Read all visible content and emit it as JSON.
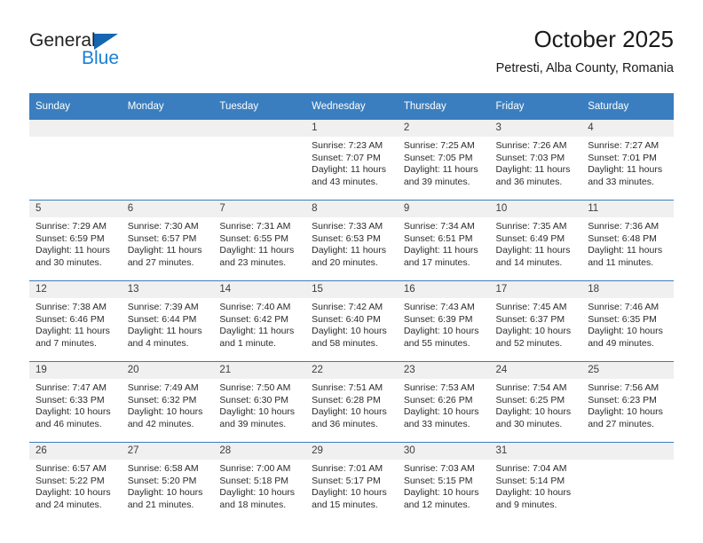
{
  "logo": {
    "word_one": "General",
    "word_two": "Blue",
    "triangle_color": "#1565b0",
    "blue_color": "#1a7fd4"
  },
  "header": {
    "title": "October 2025",
    "subtitle": "Petresti, Alba County, Romania"
  },
  "theme": {
    "header_bg": "#3a7ebf",
    "header_text": "#ffffff",
    "daynum_bg": "#f0f0f0",
    "row_divider": "#3a7ebf",
    "body_text": "#2b2b2b"
  },
  "weekdays": [
    "Sunday",
    "Monday",
    "Tuesday",
    "Wednesday",
    "Thursday",
    "Friday",
    "Saturday"
  ],
  "weeks": [
    [
      {
        "day": "",
        "empty": true
      },
      {
        "day": "",
        "empty": true
      },
      {
        "day": "",
        "empty": true
      },
      {
        "day": "1",
        "sunrise": "Sunrise: 7:23 AM",
        "sunset": "Sunset: 7:07 PM",
        "daylight1": "Daylight: 11 hours",
        "daylight2": "and 43 minutes."
      },
      {
        "day": "2",
        "sunrise": "Sunrise: 7:25 AM",
        "sunset": "Sunset: 7:05 PM",
        "daylight1": "Daylight: 11 hours",
        "daylight2": "and 39 minutes."
      },
      {
        "day": "3",
        "sunrise": "Sunrise: 7:26 AM",
        "sunset": "Sunset: 7:03 PM",
        "daylight1": "Daylight: 11 hours",
        "daylight2": "and 36 minutes."
      },
      {
        "day": "4",
        "sunrise": "Sunrise: 7:27 AM",
        "sunset": "Sunset: 7:01 PM",
        "daylight1": "Daylight: 11 hours",
        "daylight2": "and 33 minutes."
      }
    ],
    [
      {
        "day": "5",
        "sunrise": "Sunrise: 7:29 AM",
        "sunset": "Sunset: 6:59 PM",
        "daylight1": "Daylight: 11 hours",
        "daylight2": "and 30 minutes."
      },
      {
        "day": "6",
        "sunrise": "Sunrise: 7:30 AM",
        "sunset": "Sunset: 6:57 PM",
        "daylight1": "Daylight: 11 hours",
        "daylight2": "and 27 minutes."
      },
      {
        "day": "7",
        "sunrise": "Sunrise: 7:31 AM",
        "sunset": "Sunset: 6:55 PM",
        "daylight1": "Daylight: 11 hours",
        "daylight2": "and 23 minutes."
      },
      {
        "day": "8",
        "sunrise": "Sunrise: 7:33 AM",
        "sunset": "Sunset: 6:53 PM",
        "daylight1": "Daylight: 11 hours",
        "daylight2": "and 20 minutes."
      },
      {
        "day": "9",
        "sunrise": "Sunrise: 7:34 AM",
        "sunset": "Sunset: 6:51 PM",
        "daylight1": "Daylight: 11 hours",
        "daylight2": "and 17 minutes."
      },
      {
        "day": "10",
        "sunrise": "Sunrise: 7:35 AM",
        "sunset": "Sunset: 6:49 PM",
        "daylight1": "Daylight: 11 hours",
        "daylight2": "and 14 minutes."
      },
      {
        "day": "11",
        "sunrise": "Sunrise: 7:36 AM",
        "sunset": "Sunset: 6:48 PM",
        "daylight1": "Daylight: 11 hours",
        "daylight2": "and 11 minutes."
      }
    ],
    [
      {
        "day": "12",
        "sunrise": "Sunrise: 7:38 AM",
        "sunset": "Sunset: 6:46 PM",
        "daylight1": "Daylight: 11 hours",
        "daylight2": "and 7 minutes."
      },
      {
        "day": "13",
        "sunrise": "Sunrise: 7:39 AM",
        "sunset": "Sunset: 6:44 PM",
        "daylight1": "Daylight: 11 hours",
        "daylight2": "and 4 minutes."
      },
      {
        "day": "14",
        "sunrise": "Sunrise: 7:40 AM",
        "sunset": "Sunset: 6:42 PM",
        "daylight1": "Daylight: 11 hours",
        "daylight2": "and 1 minute."
      },
      {
        "day": "15",
        "sunrise": "Sunrise: 7:42 AM",
        "sunset": "Sunset: 6:40 PM",
        "daylight1": "Daylight: 10 hours",
        "daylight2": "and 58 minutes."
      },
      {
        "day": "16",
        "sunrise": "Sunrise: 7:43 AM",
        "sunset": "Sunset: 6:39 PM",
        "daylight1": "Daylight: 10 hours",
        "daylight2": "and 55 minutes."
      },
      {
        "day": "17",
        "sunrise": "Sunrise: 7:45 AM",
        "sunset": "Sunset: 6:37 PM",
        "daylight1": "Daylight: 10 hours",
        "daylight2": "and 52 minutes."
      },
      {
        "day": "18",
        "sunrise": "Sunrise: 7:46 AM",
        "sunset": "Sunset: 6:35 PM",
        "daylight1": "Daylight: 10 hours",
        "daylight2": "and 49 minutes."
      }
    ],
    [
      {
        "day": "19",
        "sunrise": "Sunrise: 7:47 AM",
        "sunset": "Sunset: 6:33 PM",
        "daylight1": "Daylight: 10 hours",
        "daylight2": "and 46 minutes."
      },
      {
        "day": "20",
        "sunrise": "Sunrise: 7:49 AM",
        "sunset": "Sunset: 6:32 PM",
        "daylight1": "Daylight: 10 hours",
        "daylight2": "and 42 minutes."
      },
      {
        "day": "21",
        "sunrise": "Sunrise: 7:50 AM",
        "sunset": "Sunset: 6:30 PM",
        "daylight1": "Daylight: 10 hours",
        "daylight2": "and 39 minutes."
      },
      {
        "day": "22",
        "sunrise": "Sunrise: 7:51 AM",
        "sunset": "Sunset: 6:28 PM",
        "daylight1": "Daylight: 10 hours",
        "daylight2": "and 36 minutes."
      },
      {
        "day": "23",
        "sunrise": "Sunrise: 7:53 AM",
        "sunset": "Sunset: 6:26 PM",
        "daylight1": "Daylight: 10 hours",
        "daylight2": "and 33 minutes."
      },
      {
        "day": "24",
        "sunrise": "Sunrise: 7:54 AM",
        "sunset": "Sunset: 6:25 PM",
        "daylight1": "Daylight: 10 hours",
        "daylight2": "and 30 minutes."
      },
      {
        "day": "25",
        "sunrise": "Sunrise: 7:56 AM",
        "sunset": "Sunset: 6:23 PM",
        "daylight1": "Daylight: 10 hours",
        "daylight2": "and 27 minutes."
      }
    ],
    [
      {
        "day": "26",
        "sunrise": "Sunrise: 6:57 AM",
        "sunset": "Sunset: 5:22 PM",
        "daylight1": "Daylight: 10 hours",
        "daylight2": "and 24 minutes."
      },
      {
        "day": "27",
        "sunrise": "Sunrise: 6:58 AM",
        "sunset": "Sunset: 5:20 PM",
        "daylight1": "Daylight: 10 hours",
        "daylight2": "and 21 minutes."
      },
      {
        "day": "28",
        "sunrise": "Sunrise: 7:00 AM",
        "sunset": "Sunset: 5:18 PM",
        "daylight1": "Daylight: 10 hours",
        "daylight2": "and 18 minutes."
      },
      {
        "day": "29",
        "sunrise": "Sunrise: 7:01 AM",
        "sunset": "Sunset: 5:17 PM",
        "daylight1": "Daylight: 10 hours",
        "daylight2": "and 15 minutes."
      },
      {
        "day": "30",
        "sunrise": "Sunrise: 7:03 AM",
        "sunset": "Sunset: 5:15 PM",
        "daylight1": "Daylight: 10 hours",
        "daylight2": "and 12 minutes."
      },
      {
        "day": "31",
        "sunrise": "Sunrise: 7:04 AM",
        "sunset": "Sunset: 5:14 PM",
        "daylight1": "Daylight: 10 hours",
        "daylight2": "and 9 minutes."
      },
      {
        "day": "",
        "empty": true
      }
    ]
  ]
}
